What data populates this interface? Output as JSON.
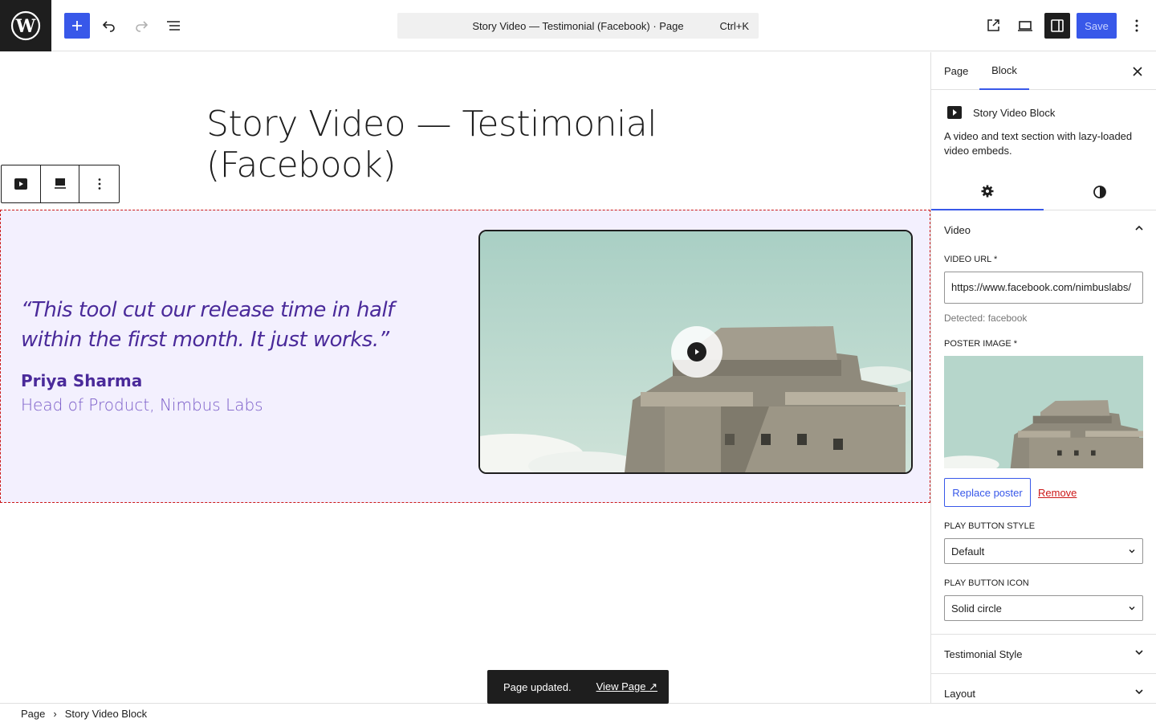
{
  "toolbar": {
    "command_bar_text": "Story Video — Testimonial (Facebook) · Page",
    "shortcut": "Ctrl+K",
    "save_label": "Save"
  },
  "editor": {
    "page_title": "Story Video — Testimonial (Facebook)",
    "quote": "“This tool cut our release time in half within the first month. It just works.”",
    "author_name": "Priya Sharma",
    "author_role": "Head of Product, Nimbus Labs"
  },
  "snackbar": {
    "message": "Page updated.",
    "link": "View Page ↗"
  },
  "breadcrumb": {
    "items": [
      "Page",
      "Story Video Block"
    ]
  },
  "sidebar": {
    "tabs": [
      "Page",
      "Block"
    ],
    "active_tab": "Block",
    "block_title": "Story Video Block",
    "block_description": "A video and text section with lazy-loaded video embeds.",
    "video_panel": {
      "title": "Video",
      "video_url_label": "VIDEO URL *",
      "video_url_value": "https://www.facebook.com/nimbuslabs/",
      "detected_text": "Detected: facebook",
      "poster_label": "POSTER IMAGE *",
      "replace_poster": "Replace poster",
      "remove": "Remove",
      "play_style_label": "PLAY BUTTON STYLE",
      "play_style_value": "Default",
      "play_icon_label": "PLAY BUTTON ICON",
      "play_icon_value": "Solid circle"
    },
    "testimonial_panel_title": "Testimonial Style",
    "layout_panel_title": "Layout"
  },
  "colors": {
    "accent": "#3858e9",
    "block_background": "#f3f0fe",
    "quote_text": "#4a2a9a",
    "danger": "#cc1818"
  }
}
